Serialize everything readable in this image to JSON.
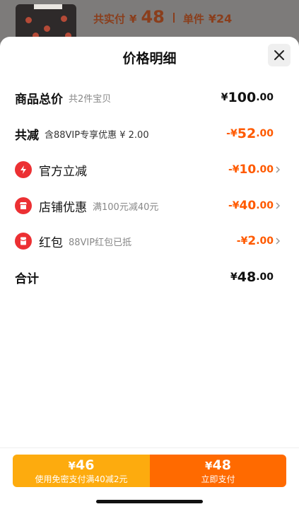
{
  "backdrop": {
    "total_label": "共实付",
    "total_currency": "¥",
    "total_value": "48",
    "unit_label": "单件",
    "unit_value": "¥24"
  },
  "sheet": {
    "title": "价格明细",
    "close_icon": "close-icon"
  },
  "rows": {
    "subtotal": {
      "label": "商品总价",
      "sub": "共2件宝贝",
      "cur": "¥",
      "int": "100",
      "dec": ".00"
    },
    "discount": {
      "label": "共减",
      "sub": "含88VIP专享优惠 ¥ 2.00",
      "cur": "-¥",
      "int": "52",
      "dec": ".00"
    },
    "official": {
      "label": "官方立减",
      "icon": "lightning-icon",
      "cur": "-¥",
      "int": "10",
      "dec": ".00"
    },
    "store": {
      "label": "店铺优惠",
      "sub": "满100元减40元",
      "icon": "store-icon",
      "cur": "-¥",
      "int": "40",
      "dec": ".00"
    },
    "redpacket": {
      "label": "红包",
      "sub": "88VIP红包已抵",
      "icon": "red-packet-icon",
      "cur": "-¥",
      "int": "2",
      "dec": ".00"
    },
    "total": {
      "label": "合计",
      "cur": "¥",
      "int": "48",
      "dec": ".00"
    }
  },
  "footer": {
    "left": {
      "cur": "¥",
      "price": "46",
      "caption": "使用免密支付满40减2元"
    },
    "right": {
      "cur": "¥",
      "price": "48",
      "caption": "立即支付"
    }
  },
  "colors": {
    "accent": "#ff5a00",
    "red": "#ec3033",
    "gold": "#fdab0e",
    "orange": "#ff6a00"
  }
}
